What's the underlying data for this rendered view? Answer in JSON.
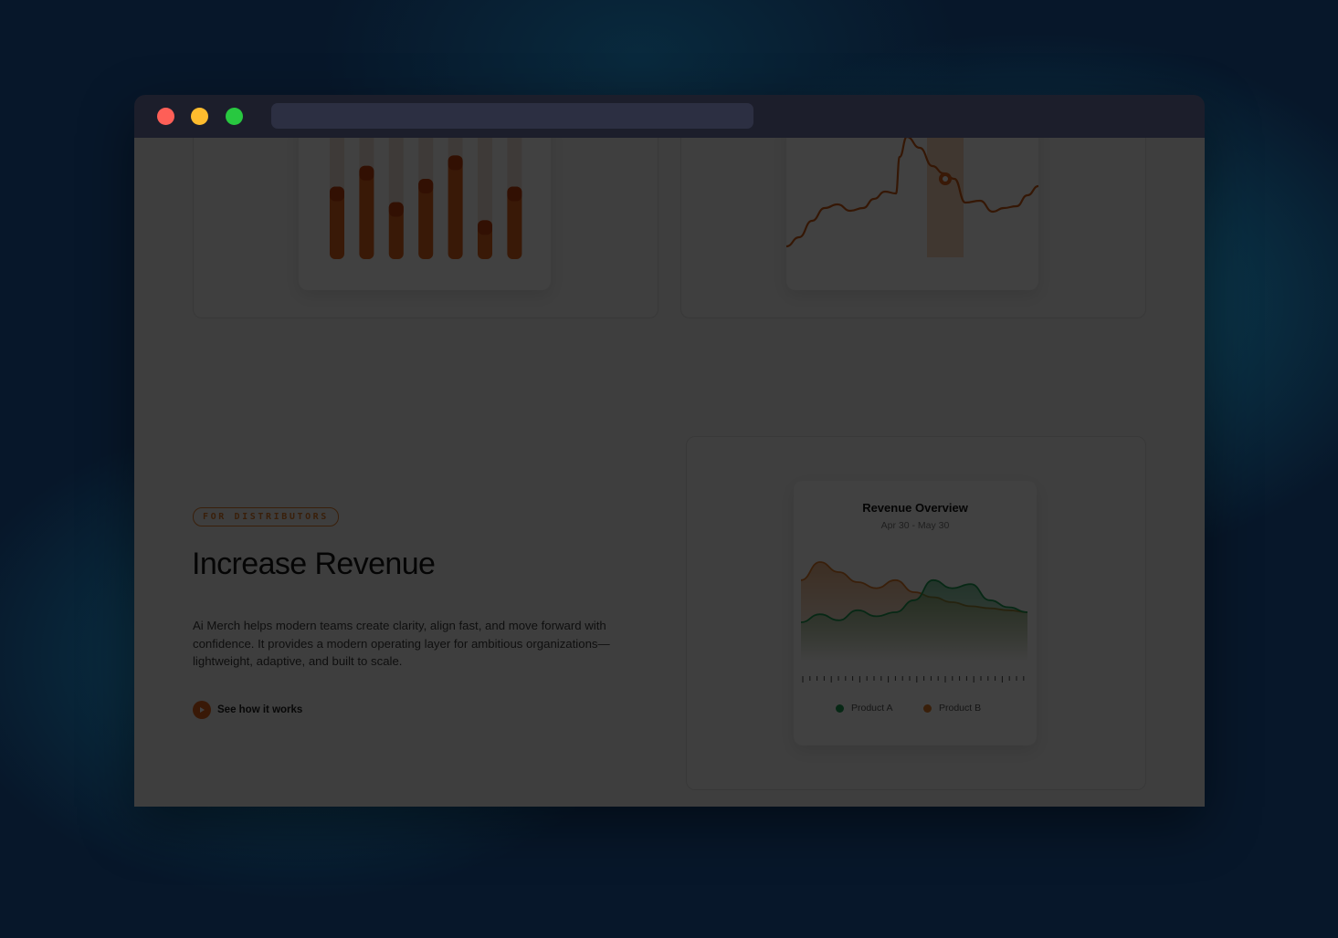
{
  "window": {
    "dots": [
      "close",
      "minimize",
      "maximize"
    ],
    "url": ""
  },
  "colors": {
    "accent": "#e0621e",
    "product_a": "#1f9d55",
    "product_b": "#e07a2a"
  },
  "bar_chart": {
    "categories": [
      "",
      "",
      "",
      "",
      "",
      "",
      ""
    ],
    "values": [
      0.56,
      0.72,
      0.44,
      0.62,
      0.8,
      0.3,
      0.56
    ]
  },
  "line_chart": {
    "categories": [
      "",
      "",
      "",
      "",
      "",
      "",
      ""
    ],
    "highlight_index": 4
  },
  "feature": {
    "tag": "FOR DISTRIBUTORS",
    "title": "Increase Revenue",
    "body": "Ai Merch helps modern teams create clarity, align fast, and move forward with confidence. It provides a modern operating layer for ambitious organizations—lightweight, adaptive, and built to scale.",
    "cta_label": "See how it works",
    "cta_icon": "play-icon"
  },
  "chart_data": {
    "type": "area",
    "title": "Revenue Overview",
    "subtitle": "Apr 30 - May 30",
    "x": [
      0,
      1,
      2,
      3,
      4,
      5,
      6,
      7,
      8,
      9,
      10,
      11,
      12
    ],
    "series": [
      {
        "name": "Product A",
        "color": "#1f9d55",
        "values": [
          30,
          38,
          32,
          42,
          36,
          40,
          52,
          72,
          64,
          68,
          52,
          45,
          40
        ]
      },
      {
        "name": "Product B",
        "color": "#e07a2a",
        "values": [
          72,
          90,
          80,
          70,
          64,
          72,
          60,
          55,
          50,
          46,
          44,
          42,
          40
        ]
      }
    ],
    "legend_position": "bottom",
    "grid": false
  }
}
